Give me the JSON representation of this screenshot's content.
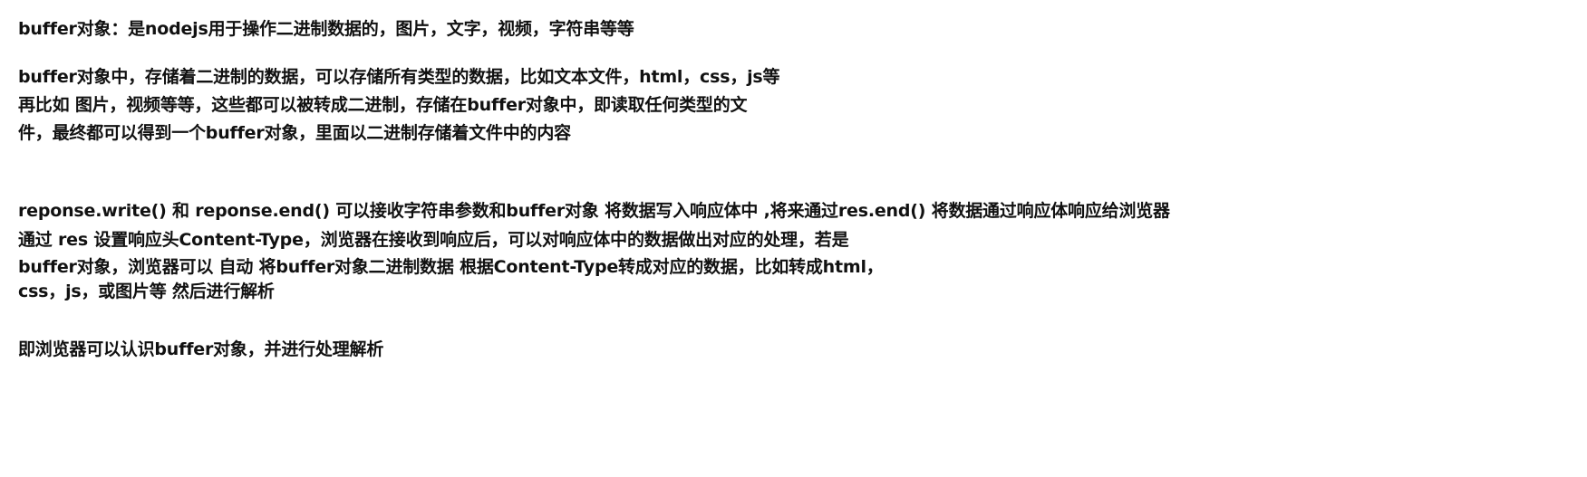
{
  "document": {
    "lines": [
      "buffer对象：是nodejs用于操作二进制数据的，图片，文字，视频，字符串等等",
      "buffer对象中，存储着二进制的数据，可以存储所有类型的数据，比如文本文件，html，css，js等",
      "再比如 图片，视频等等，这些都可以被转成二进制，存储在buffer对象中，即读取任何类型的文",
      "件，最终都可以得到一个buffer对象，里面以二进制存储着文件中的内容",
      "reponse.write() 和 reponse.end() 可以接收字符串参数和buffer对象 将数据写入响应体中   ,将来通过res.end() 将数据通过响应体响应给浏览器",
      "通过 res 设置响应头Content-Type，浏览器在接收到响应后，可以对响应体中的数据做出对应的处理，若是",
      "buffer对象，浏览器可以 自动 将buffer对象二进制数据 根据Content-Type转成对应的数据，比如转成html，",
      "css，js，或图片等   然后进行解析",
      "即浏览器可以认识buffer对象，并进行处理解析"
    ]
  }
}
